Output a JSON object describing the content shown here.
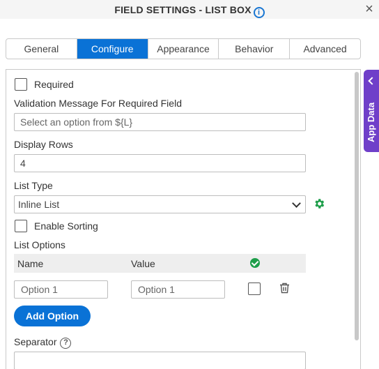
{
  "header": {
    "title": "FIELD SETTINGS - LIST BOX",
    "info_glyph": "i",
    "close_glyph": "×"
  },
  "tabs": [
    {
      "label": "General",
      "active": false
    },
    {
      "label": "Configure",
      "active": true
    },
    {
      "label": "Appearance",
      "active": false
    },
    {
      "label": "Behavior",
      "active": false
    },
    {
      "label": "Advanced",
      "active": false
    }
  ],
  "form": {
    "required_label": "Required",
    "validation_label": "Validation Message For Required Field",
    "validation_placeholder": "Select an option from ${L}",
    "display_rows_label": "Display Rows",
    "display_rows_value": "4",
    "list_type_label": "List Type",
    "list_type_value": "Inline List",
    "enable_sorting_label": "Enable Sorting",
    "list_options_label": "List Options",
    "separator_label": "Separator",
    "help_glyph": "?"
  },
  "table": {
    "col_name": "Name",
    "col_value": "Value",
    "rows": [
      {
        "name_placeholder": "Option 1",
        "value_placeholder": "Option 1"
      }
    ]
  },
  "add_option_label": "Add Option",
  "side_panel": {
    "label": "App Data"
  },
  "colors": {
    "accent": "#0a72d6",
    "success": "#1e9e4a",
    "side_panel": "#6f3fc9"
  },
  "icons": [
    "info-icon",
    "close-icon",
    "gear-icon",
    "check-circle-icon",
    "trash-icon",
    "help-icon",
    "chevron-down-icon",
    "chevron-left-icon"
  ]
}
